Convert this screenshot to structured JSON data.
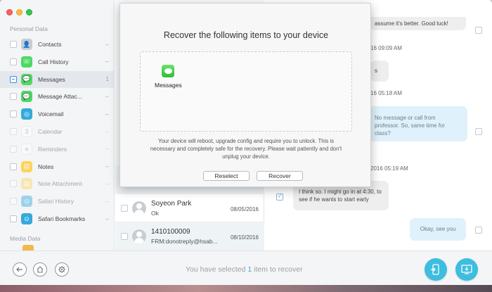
{
  "sidebar": {
    "personal_title": "Personal Data",
    "media_title": "Media Data",
    "items": [
      {
        "label": "Contacts",
        "count": "--",
        "color": "#c9ccd0",
        "glyph": "👤",
        "dim": false
      },
      {
        "label": "Call History",
        "count": "--",
        "color": "#4cd964",
        "glyph": "☏",
        "dim": false
      },
      {
        "label": "Messages",
        "count": "1",
        "color": "#4cd964",
        "glyph": "💬",
        "dim": false
      },
      {
        "label": "Message Attac...",
        "count": "--",
        "color": "#4cd964",
        "glyph": "💬",
        "dim": false
      },
      {
        "label": "Voicemail",
        "count": "--",
        "color": "#34aadc",
        "glyph": "◎",
        "dim": false
      },
      {
        "label": "Calendar",
        "count": "--",
        "color": "#ffffff",
        "glyph": "3",
        "dim": true
      },
      {
        "label": "Reminders",
        "count": "--",
        "color": "#ffffff",
        "glyph": "≡",
        "dim": true
      },
      {
        "label": "Notes",
        "count": "--",
        "color": "#ffd25c",
        "glyph": "▤",
        "dim": false
      },
      {
        "label": "Note Attachment",
        "count": "--",
        "color": "#ffd25c",
        "glyph": "▤",
        "dim": true
      },
      {
        "label": "Safari History",
        "count": "--",
        "color": "#34aadc",
        "glyph": "⊙",
        "dim": true
      },
      {
        "label": "Safari Bookmarks",
        "count": "--",
        "color": "#34aadc",
        "glyph": "⊙",
        "dim": false
      }
    ]
  },
  "list": {
    "rows": [
      {
        "name": "Soyeon Park",
        "sub": "Ok",
        "date": "08/05/2016"
      },
      {
        "name": "1410100009",
        "sub": "FRM:donotreply@hsab...",
        "date": "08/10/2016"
      }
    ]
  },
  "chat": {
    "bubble1": "assume it's better. Good luck!",
    "time1": "16 09:09 AM",
    "bubble2": "s",
    "time2": "16 05:18 AM",
    "bubble3": "No message or call from professor. So, same time for class?",
    "time3": "2016 05:19 AM",
    "bubble4": "I think so. I might go in at 4:30, to see if he wants to start early",
    "bubble5": "Okay, see you"
  },
  "footer": {
    "text_before": "You have selected ",
    "count": "1",
    "text_after": " item to recover"
  },
  "modal": {
    "title": "Recover the following items to your device",
    "item_label": "Messages",
    "description": "Your device will reboot, upgrade config and require you to unlock. This is necessary and completely safe for the recovery. Please wait patiently and don't unplug your device.",
    "reselect_label": "Reselect",
    "recover_label": "Recover"
  },
  "colors": {
    "accent": "#3dbde0",
    "selected_count": "#3ab0d9",
    "out_bubble": "#dff1fb"
  }
}
